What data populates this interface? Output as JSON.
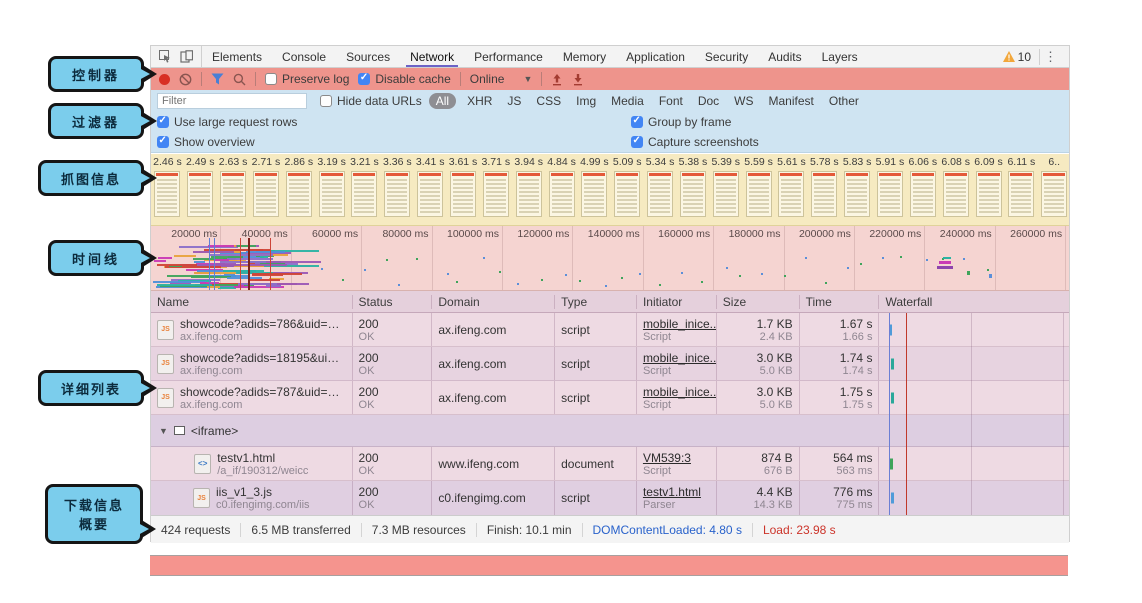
{
  "annotations": {
    "controller": "控制器",
    "filter": "过滤器",
    "screenshot_info": "抓图信息",
    "timeline": "时间线",
    "detail_list": "详细列表",
    "download_line1": "下载信息",
    "download_line2": "概要"
  },
  "devtools": {
    "tabs": [
      "Elements",
      "Console",
      "Sources",
      "Network",
      "Performance",
      "Memory",
      "Application",
      "Security",
      "Audits",
      "Layers"
    ],
    "warning_count": "10",
    "toolbar": {
      "preserve_log": "Preserve log",
      "disable_cache": "Disable cache",
      "throttle": "Online"
    },
    "filter_bar": {
      "placeholder": "Filter",
      "hide_data_urls": "Hide data URLs",
      "pills": [
        "All",
        "XHR",
        "JS",
        "CSS",
        "Img",
        "Media",
        "Font",
        "Doc",
        "WS",
        "Manifest",
        "Other"
      ]
    },
    "options": {
      "use_large_rows": "Use large request rows",
      "group_by_frame": "Group by frame",
      "show_overview": "Show overview",
      "capture_screenshots": "Capture screenshots"
    },
    "filmstrip_times": [
      "2.46 s",
      "2.49 s",
      "2.63 s",
      "2.71 s",
      "2.86 s",
      "3.19 s",
      "3.21 s",
      "3.36 s",
      "3.41 s",
      "3.61 s",
      "3.71 s",
      "3.94 s",
      "4.84 s",
      "4.99 s",
      "5.09 s",
      "5.34 s",
      "5.38 s",
      "5.39 s",
      "5.59 s",
      "5.61 s",
      "5.78 s",
      "5.83 s",
      "5.91 s",
      "6.06 s",
      "6.08 s",
      "6.09 s",
      "6.11 s",
      "6.."
    ],
    "timeline_ticks": [
      "20000 ms",
      "40000 ms",
      "60000 ms",
      "80000 ms",
      "100000 ms",
      "120000 ms",
      "140000 ms",
      "160000 ms",
      "180000 ms",
      "200000 ms",
      "220000 ms",
      "240000 ms",
      "260000 ms"
    ],
    "waterfall_palette": [
      "#4f8fd9",
      "#c93ab5",
      "#3fa45b",
      "#e8a33d",
      "#9b59b6",
      "#2bb3a3",
      "#d04437",
      "#8b6fc9"
    ],
    "table": {
      "columns": [
        "Name",
        "Status",
        "Domain",
        "Type",
        "Initiator",
        "Size",
        "Time",
        "Waterfall"
      ],
      "group_row_label": "<iframe>",
      "rows": [
        {
          "icon": "JS",
          "name": "showcode?adids=786&uid=1565...",
          "name_sub": "ax.ifeng.com",
          "status": "200",
          "status_sub": "OK",
          "domain": "ax.ifeng.com",
          "type": "script",
          "initiator": "mobile_inice...",
          "initiator_sub": "Script",
          "size": "1.7 KB",
          "size_sub": "2.4 KB",
          "time": "1.67 s",
          "time_sub": "1.66 s",
          "bar_color": "#4f9bd9"
        },
        {
          "icon": "JS",
          "name": "showcode?adids=18195&uid=15...",
          "name_sub": "ax.ifeng.com",
          "status": "200",
          "status_sub": "OK",
          "domain": "ax.ifeng.com",
          "type": "script",
          "initiator": "mobile_inice...",
          "initiator_sub": "Script",
          "size": "3.0 KB",
          "size_sub": "5.0 KB",
          "time": "1.74 s",
          "time_sub": "1.74 s",
          "bar_color": "#2aa89a"
        },
        {
          "icon": "JS",
          "name": "showcode?adids=787&uid=1565...",
          "name_sub": "ax.ifeng.com",
          "status": "200",
          "status_sub": "OK",
          "domain": "ax.ifeng.com",
          "type": "script",
          "initiator": "mobile_inice...",
          "initiator_sub": "Script",
          "size": "3.0 KB",
          "size_sub": "5.0 KB",
          "time": "1.75 s",
          "time_sub": "1.75 s",
          "bar_color": "#2aa89a"
        },
        {
          "icon": "<>",
          "name": "testv1.html",
          "name_sub": "/a_if/190312/weicc",
          "status": "200",
          "status_sub": "OK",
          "domain": "www.ifeng.com",
          "type": "document",
          "initiator": "VM539:3",
          "initiator_sub": "Script",
          "size": "874 B",
          "size_sub": "676 B",
          "time": "564 ms",
          "time_sub": "563 ms",
          "bar_color": "#3fa45b"
        },
        {
          "icon": "JS",
          "name": "iis_v1_3.js",
          "name_sub": "c0.ifengimg.com/iis",
          "status": "200",
          "status_sub": "OK",
          "domain": "c0.ifengimg.com",
          "type": "script",
          "initiator": "testv1.html",
          "initiator_sub": "Parser",
          "size": "4.4 KB",
          "size_sub": "14.3 KB",
          "time": "776 ms",
          "time_sub": "775 ms",
          "bar_color": "#4f9bd9"
        }
      ]
    },
    "statusbar": {
      "requests": "424 requests",
      "transferred": "6.5 MB transferred",
      "resources": "7.3 MB resources",
      "finish": "Finish: 10.1 min",
      "dcl": "DOMContentLoaded: 4.80 s",
      "load": "Load: 23.98 s"
    }
  }
}
